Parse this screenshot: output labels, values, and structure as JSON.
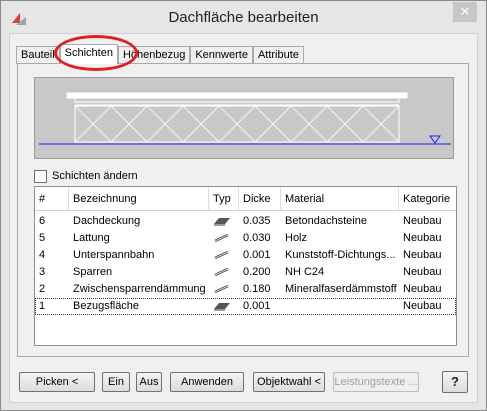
{
  "window": {
    "title": "Dachfläche bearbeiten",
    "close_glyph": "✕"
  },
  "tabs": [
    {
      "label": "Bauteil",
      "active": false
    },
    {
      "label": "Schichten",
      "active": true
    },
    {
      "label": "Höhenbezug",
      "active": false
    },
    {
      "label": "Kennwerte",
      "active": false
    },
    {
      "label": "Attribute",
      "active": false
    }
  ],
  "checkbox": {
    "label": "Schichten ändern",
    "checked": false
  },
  "table": {
    "headers": [
      "#",
      "Bezeichnung",
      "Typ",
      "Dicke",
      "Material",
      "Kategorie"
    ],
    "rows": [
      {
        "num": "6",
        "name": "Dachdeckung",
        "type_icon": "tile-layer-icon",
        "thickness": "0.035",
        "material": "Betondachsteine",
        "category": "Neubau"
      },
      {
        "num": "5",
        "name": "Lattung",
        "type_icon": "batten-layer-icon",
        "thickness": "0.030",
        "material": "Holz",
        "category": "Neubau"
      },
      {
        "num": "4",
        "name": "Unterspannbahn",
        "type_icon": "membrane-layer-icon",
        "thickness": "0.001",
        "material": "Kunststoff-Dichtungs...",
        "category": "Neubau"
      },
      {
        "num": "3",
        "name": "Sparren",
        "type_icon": "rafter-layer-icon",
        "thickness": "0.200",
        "material": "NH C24",
        "category": "Neubau"
      },
      {
        "num": "2",
        "name": "Zwischensparrendämmung",
        "type_icon": "insulation-layer-icon",
        "thickness": "0.180",
        "material": "Mineralfaserdämmstoff",
        "category": "Neubau"
      },
      {
        "num": "1",
        "name": "Bezugsfläche",
        "type_icon": "reference-layer-icon",
        "thickness": "0.001",
        "material": "",
        "category": "Neubau"
      }
    ]
  },
  "buttons": {
    "picken": "Picken <",
    "ein": "Ein",
    "aus": "Aus",
    "anwenden": "Anwenden",
    "objektwahl": "Objektwahl <",
    "leistungstexte": "Leistungstexte ...",
    "help": "?"
  },
  "colors": {
    "highlight": "#e0201d",
    "reference_line": "#1a1aff",
    "preview_bg": "#c8c8c8"
  }
}
